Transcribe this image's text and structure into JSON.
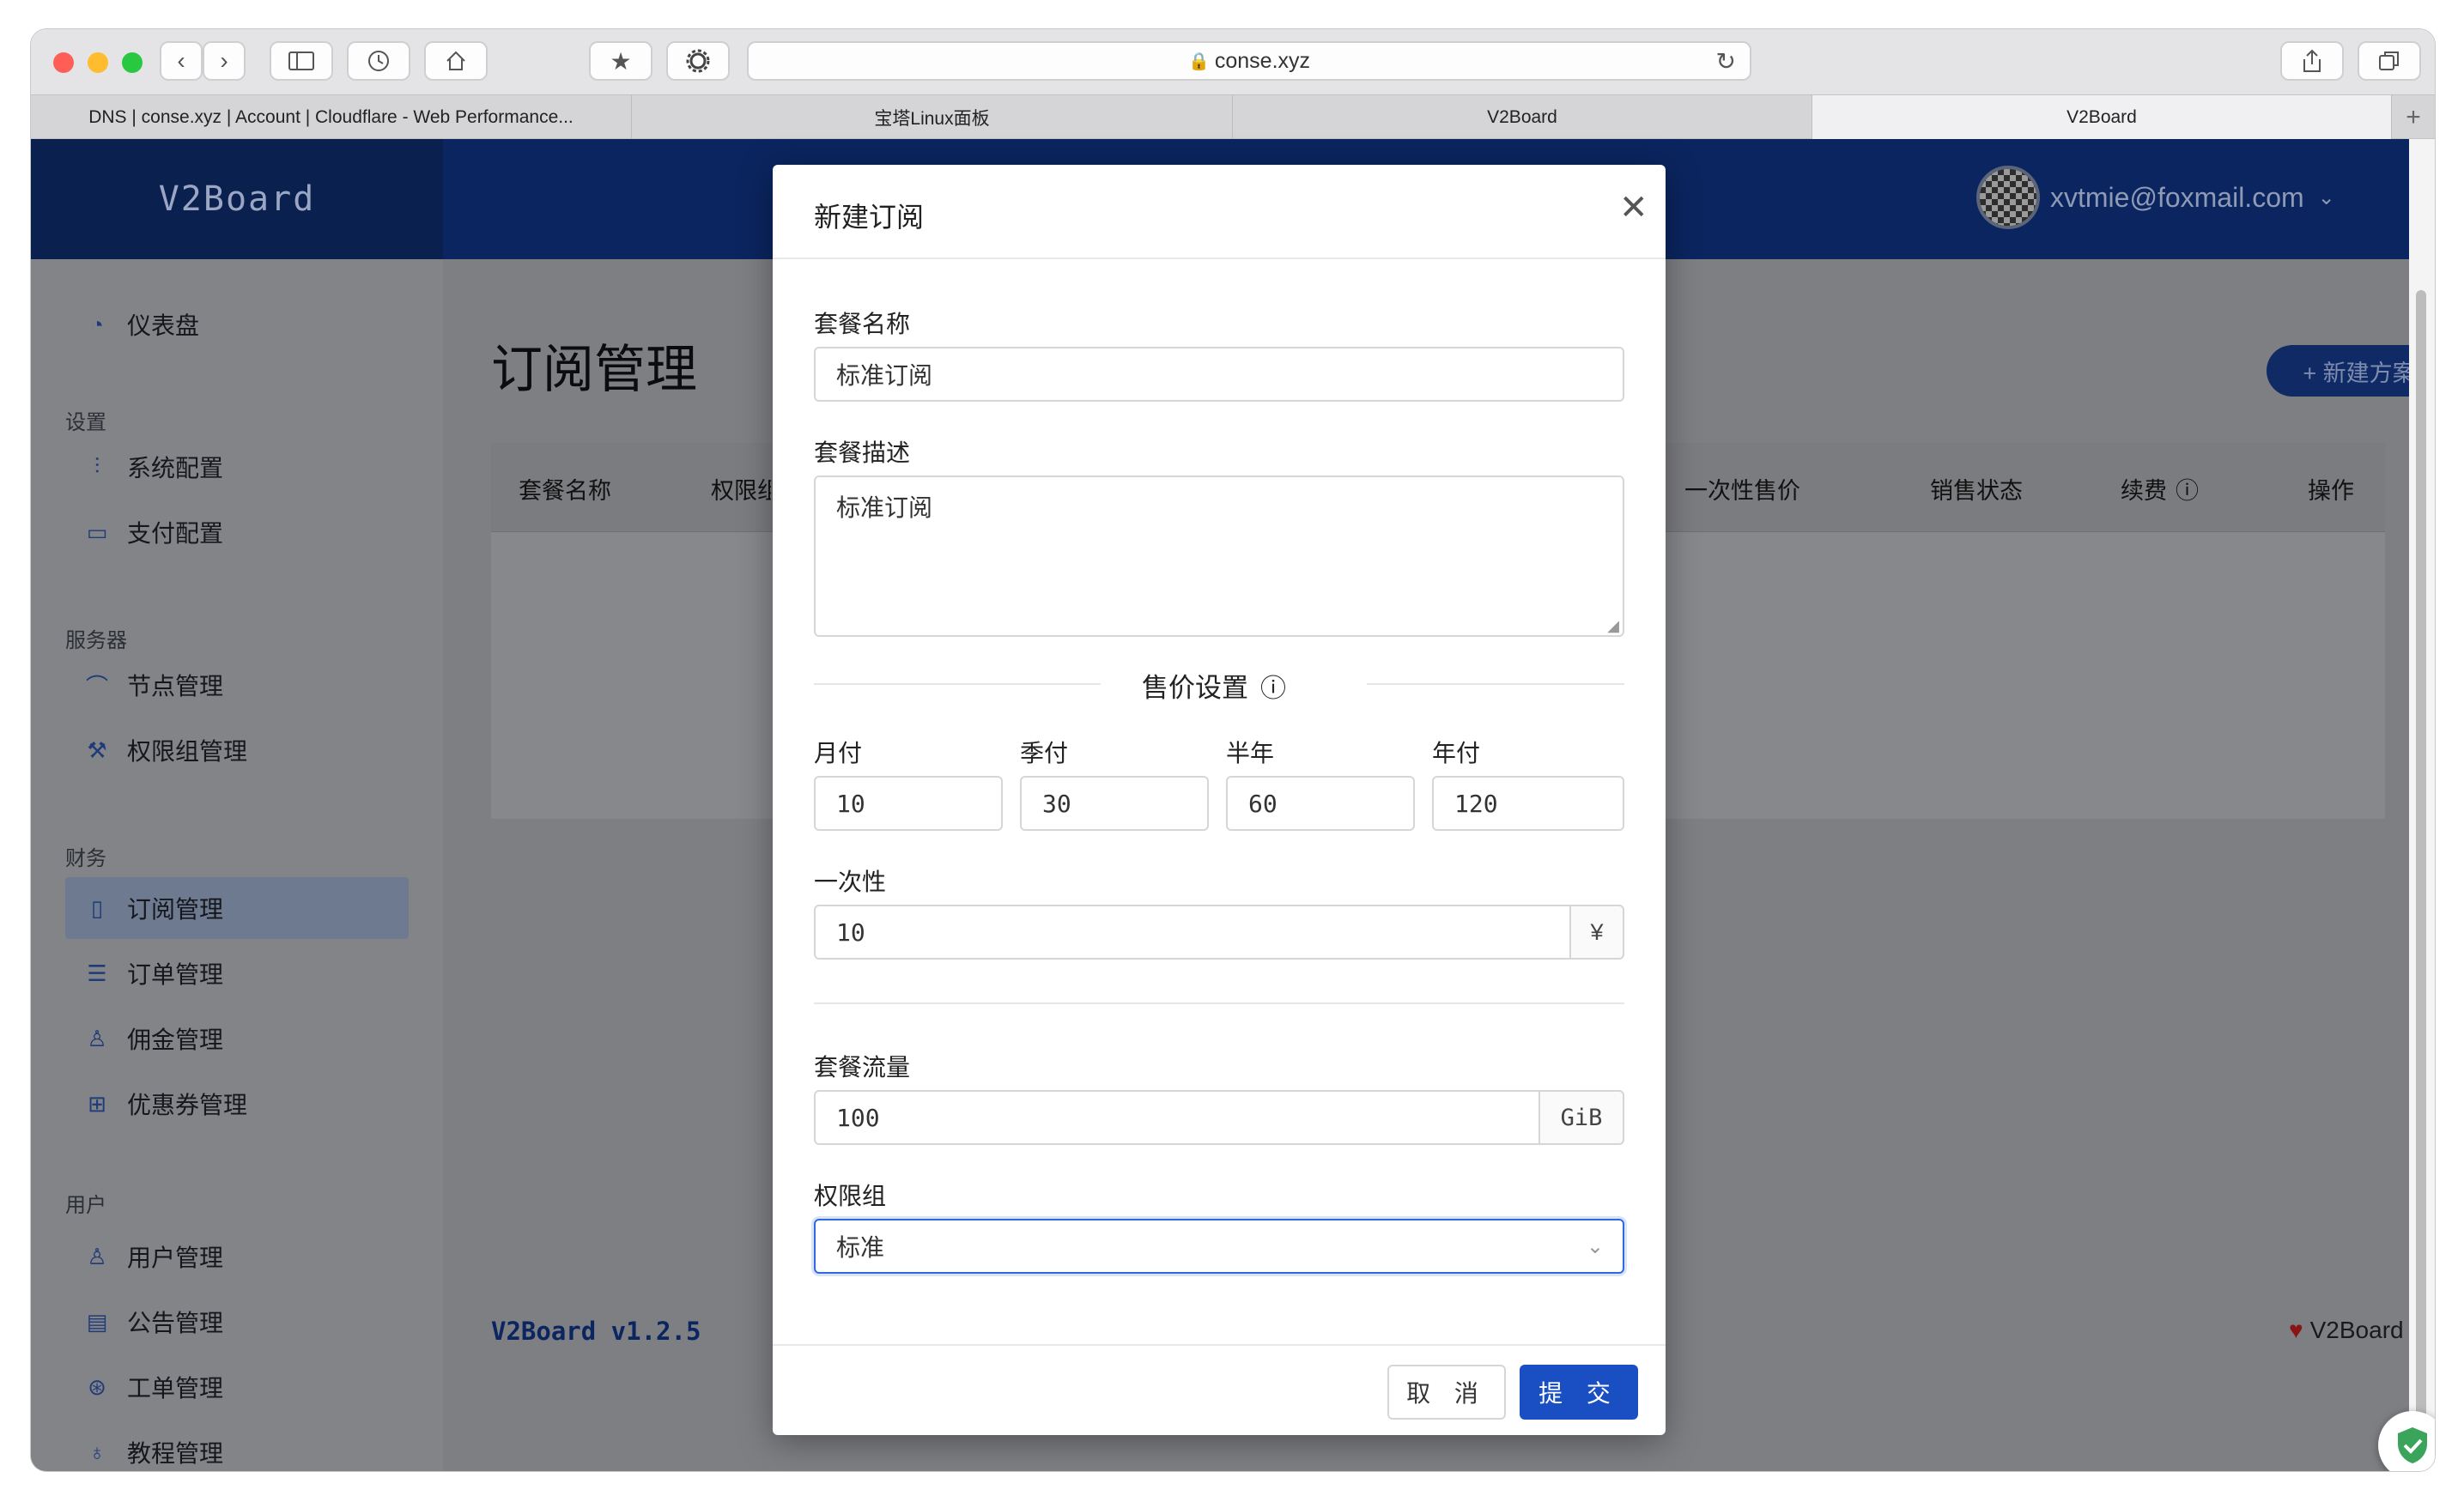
{
  "browser": {
    "url": "conse.xyz",
    "tabs": [
      "DNS | conse.xyz | Account | Cloudflare - Web Performance...",
      "宝塔Linux面板",
      "V2Board",
      "V2Board"
    ]
  },
  "header": {
    "logo": "V2Board",
    "user_email": "xvtmie@foxmail.com"
  },
  "sidebar": {
    "dashboard": "仪表盘",
    "sections": {
      "settings": "设置",
      "server": "服务器",
      "finance": "财务",
      "users": "用户"
    },
    "items": {
      "system_config": "系统配置",
      "payment_config": "支付配置",
      "node_manage": "节点管理",
      "group_manage": "权限组管理",
      "plan_manage": "订阅管理",
      "order_manage": "订单管理",
      "commission_manage": "佣金管理",
      "coupon_manage": "优惠券管理",
      "user_manage": "用户管理",
      "notice_manage": "公告管理",
      "ticket_manage": "工单管理",
      "tutorial_manage": "教程管理"
    }
  },
  "main": {
    "title": "订阅管理",
    "new_plan_button": "+ 新建方案",
    "columns": [
      "套餐名称",
      "权限组",
      "一次性售价",
      "销售状态",
      "续费",
      "操作"
    ],
    "version": "V2Board v1.2.5",
    "footer_right": "V2Board"
  },
  "modal": {
    "title": "新建订阅",
    "name_label": "套餐名称",
    "name_value": "标准订阅",
    "desc_label": "套餐描述",
    "desc_value": "标准订阅",
    "price_section": "售价设置",
    "month_label": "月付",
    "month_value": "10",
    "quarter_label": "季付",
    "quarter_value": "30",
    "half_label": "半年",
    "half_value": "60",
    "year_label": "年付",
    "year_value": "120",
    "onetime_label": "一次性",
    "onetime_value": "10",
    "currency": "¥",
    "traffic_label": "套餐流量",
    "traffic_value": "100",
    "traffic_unit": "GiB",
    "group_label": "权限组",
    "group_value": "标准",
    "cancel_button": "取 消",
    "submit_button": "提 交"
  },
  "colors": {
    "primary": "#1a4fc4",
    "header_bg": "#0b2560"
  }
}
